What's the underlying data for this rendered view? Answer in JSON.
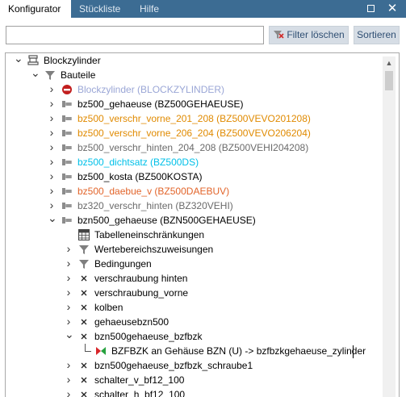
{
  "tabs": [
    {
      "label": "Konfigurator",
      "active": true
    },
    {
      "label": "Stückliste",
      "active": false
    },
    {
      "label": "Hilfe",
      "active": false
    }
  ],
  "search": {
    "value": "",
    "placeholder": ""
  },
  "buttons": {
    "filter_clear": "Filter löschen",
    "sort": "Sortieren"
  },
  "colors": {
    "header_bg": "#3c6c93",
    "orange": "#e08a00",
    "cyan": "#00c0e8",
    "red_orange": "#e2642a",
    "gray": "#6a6a6a",
    "light_blue": "#9aa6d6",
    "button_bg": "#d6dde5"
  },
  "tree": [
    {
      "depth": 0,
      "toggle": "open",
      "icon": "machine-icon",
      "label": "Blockzylinder",
      "color": "#000000"
    },
    {
      "depth": 1,
      "toggle": "open",
      "icon": "funnel-icon",
      "label": "Bauteile",
      "color": "#000000"
    },
    {
      "depth": 2,
      "toggle": "closed",
      "icon": "stop-sign-icon",
      "label": "Blockzylinder (BLOCKZYLINDER)",
      "color": "#9aa6d6"
    },
    {
      "depth": 2,
      "toggle": "closed",
      "icon": "bolt-icon",
      "label": "bz500_gehaeuse (BZ500GEHAEUSE)",
      "color": "#000000"
    },
    {
      "depth": 2,
      "toggle": "closed",
      "icon": "bolt-icon",
      "label": "bz500_verschr_vorne_201_208 (BZ500VEVO201208)",
      "color": "#e08a00"
    },
    {
      "depth": 2,
      "toggle": "closed",
      "icon": "bolt-icon",
      "label": "bz500_verschr_vorne_206_204 (BZ500VEVO206204)",
      "color": "#e08a00"
    },
    {
      "depth": 2,
      "toggle": "closed",
      "icon": "bolt-icon",
      "label": "bz500_verschr_hinten_204_208 (BZ500VEHI204208)",
      "color": "#6a6a6a"
    },
    {
      "depth": 2,
      "toggle": "closed",
      "icon": "bolt-icon",
      "label": "bz500_dichtsatz (BZ500DS)",
      "color": "#00c0e8"
    },
    {
      "depth": 2,
      "toggle": "closed",
      "icon": "bolt-icon",
      "label": "bz500_kosta (BZ500KOSTA)",
      "color": "#000000"
    },
    {
      "depth": 2,
      "toggle": "closed",
      "icon": "bolt-icon",
      "label": "bz500_daebue_v (BZ500DAEBUV)",
      "color": "#e2642a"
    },
    {
      "depth": 2,
      "toggle": "closed",
      "icon": "bolt-icon",
      "label": "bz320_verschr_hinten (BZ320VEHI)",
      "color": "#6a6a6a"
    },
    {
      "depth": 2,
      "toggle": "open",
      "icon": "bolt-icon",
      "label": "bzn500_gehaeuse (BZN500GEHAEUSE)",
      "color": "#000000"
    },
    {
      "depth": 3,
      "toggle": "none",
      "icon": "table-icon",
      "label": "Tabelleneinschränkungen",
      "color": "#000000"
    },
    {
      "depth": 3,
      "toggle": "closed",
      "icon": "funnel-icon",
      "label": "Wertebereichszuweisungen",
      "color": "#000000"
    },
    {
      "depth": 3,
      "toggle": "closed",
      "icon": "funnel-icon",
      "label": "Bedingungen",
      "color": "#000000"
    },
    {
      "depth": 3,
      "toggle": "closed",
      "icon": "x-icon",
      "label": "verschraubung hinten",
      "color": "#000000"
    },
    {
      "depth": 3,
      "toggle": "closed",
      "icon": "x-icon",
      "label": "verschraubung_vorne",
      "color": "#000000"
    },
    {
      "depth": 3,
      "toggle": "closed",
      "icon": "x-icon",
      "label": "kolben",
      "color": "#000000"
    },
    {
      "depth": 3,
      "toggle": "closed",
      "icon": "x-icon",
      "label": "gehaeusebzn500",
      "color": "#000000"
    },
    {
      "depth": 3,
      "toggle": "open",
      "icon": "x-icon",
      "label": "bzn500gehaeuse_bzfbzk",
      "color": "#000000"
    },
    {
      "depth": 4,
      "toggle": "leaf",
      "icon": "bowtie-icon",
      "label": "BZFBZK an Gehäuse BZN (U) -> bzfbzkgehaeuse_zylinder",
      "color": "#000000"
    },
    {
      "depth": 3,
      "toggle": "closed",
      "icon": "x-icon",
      "label": "bzn500gehaeuse_bzfbzk_schraube1",
      "color": "#000000"
    },
    {
      "depth": 3,
      "toggle": "closed",
      "icon": "x-icon",
      "label": "schalter_v_bf12_100",
      "color": "#000000"
    },
    {
      "depth": 3,
      "toggle": "closed",
      "icon": "x-icon",
      "label": "schalter_h_bf12_100",
      "color": "#000000"
    }
  ]
}
